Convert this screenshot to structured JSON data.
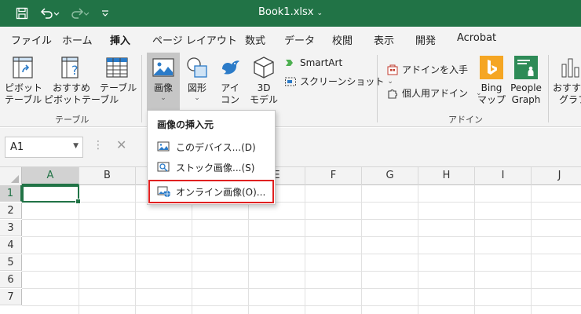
{
  "titlebar": {
    "title": "Book1.xlsx",
    "title_caret": "⌄",
    "icons": [
      "save-icon",
      "undo-icon",
      "redo-icon",
      "customize-qat-icon"
    ],
    "bg_color": "#217346"
  },
  "tabs": [
    {
      "label": "ファイル"
    },
    {
      "label": "ホーム"
    },
    {
      "label": "挿入",
      "active": true
    },
    {
      "label": "ページ レイアウト"
    },
    {
      "label": "数式"
    },
    {
      "label": "データ"
    },
    {
      "label": "校閲"
    },
    {
      "label": "表示"
    },
    {
      "label": "開発"
    },
    {
      "label": "Acrobat"
    }
  ],
  "ribbon": {
    "table_group": {
      "label": "テーブル",
      "pivot": [
        "ピボット",
        "テーブル"
      ],
      "recommended_pivot": [
        "おすすめ",
        "ピボットテーブル"
      ],
      "table": "テーブル"
    },
    "illustrations": {
      "images": "画像",
      "shapes": "図形",
      "icons": [
        "アイ",
        "コン"
      ],
      "models3d": [
        "3D",
        "モデル"
      ],
      "smartart": "SmartArt",
      "screenshot": "スクリーンショット"
    },
    "addins_group": {
      "label": "アドイン",
      "get_addins": "アドインを入手",
      "personal_addins": "個人用アドイン",
      "bing": [
        "Bing",
        "マップ"
      ],
      "people_graph": [
        "People",
        "Graph"
      ]
    },
    "recommended_charts": [
      "おすすめ",
      "グラフ"
    ]
  },
  "formula_bar": {
    "name_box": "A1",
    "cancel_symbol": "✕"
  },
  "grid": {
    "columns": [
      "A",
      "B",
      "C",
      "D",
      "E",
      "F",
      "G",
      "H",
      "I",
      "J"
    ],
    "rows": [
      "1",
      "2",
      "3",
      "4",
      "5",
      "6",
      "7"
    ],
    "active_cell": "A1"
  },
  "image_menu": {
    "title": "画像の挿入元",
    "items": [
      {
        "label": "このデバイス...(D)"
      },
      {
        "label": "ストック画像...(S)"
      },
      {
        "label": "オンライン画像(O)...",
        "highlighted": true
      }
    ],
    "highlight_color": "#e02020"
  }
}
